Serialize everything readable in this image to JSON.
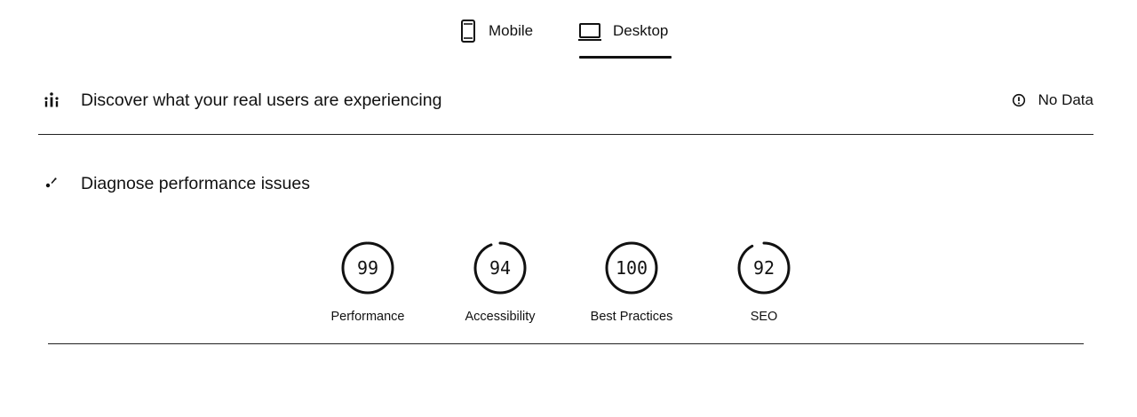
{
  "tabs": [
    {
      "label": "Mobile",
      "icon": "smartphone-icon",
      "selected": false
    },
    {
      "label": "Desktop",
      "icon": "laptop-icon",
      "selected": true
    }
  ],
  "field_data": {
    "title": "Discover what your real users are experiencing",
    "icon": "users-icon",
    "status_icon": "info-circle-icon",
    "status": "No Data"
  },
  "lab_data": {
    "title": "Diagnose performance issues",
    "icon": "diagnose-icon",
    "scores": [
      {
        "label": "Performance",
        "score": "99",
        "fraction": 0.99
      },
      {
        "label": "Accessibility",
        "score": "94",
        "fraction": 0.94
      },
      {
        "label": "Best Practices",
        "score": "100",
        "fraction": 1.0
      },
      {
        "label": "SEO",
        "score": "92",
        "fraction": 0.92
      }
    ]
  }
}
